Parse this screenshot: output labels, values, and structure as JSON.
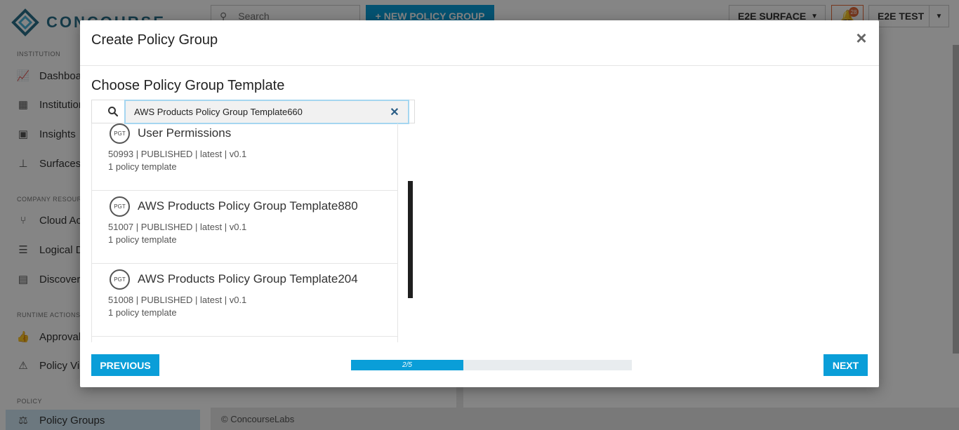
{
  "app": {
    "logo_text": "CONCOURSE",
    "search_placeholder": "Search",
    "new_policy_group_label": "NEW POLICY GROUP",
    "surface_selector": "E2E SURFACE",
    "notification_count": "28",
    "user_selector": "E2E TEST",
    "footer": "© ConcourseLabs"
  },
  "sidebar": {
    "sections": [
      {
        "label": "INSTITUTION",
        "items": [
          "Dashboard",
          "Institution",
          "Insights",
          "Surfaces"
        ]
      },
      {
        "label": "COMPANY RESOURCES",
        "items": [
          "Cloud Accounts",
          "Logical Deployables",
          "Discovery"
        ]
      },
      {
        "label": "RUNTIME ACTIONS",
        "items": [
          "Approvals",
          "Policy Violations"
        ]
      },
      {
        "label": "POLICY",
        "items": [
          "Policy Groups"
        ]
      }
    ]
  },
  "modal": {
    "title": "Create Policy Group",
    "section_title": "Choose Policy Group Template",
    "search_value": "AWS Products Policy Group Template660",
    "templates": [
      {
        "badge": "PGT",
        "name": "User Permissions",
        "meta": "50993 | PUBLISHED | latest | v0.1",
        "count": "1 policy template"
      },
      {
        "badge": "PGT",
        "name": "AWS Products Policy Group Template880",
        "meta": "51007 | PUBLISHED | latest | v0.1",
        "count": "1 policy template"
      },
      {
        "badge": "PGT",
        "name": "AWS Products Policy Group Template204",
        "meta": "51008 | PUBLISHED | latest | v0.1",
        "count": "1 policy template"
      }
    ],
    "previous_label": "PREVIOUS",
    "next_label": "NEXT",
    "progress": {
      "label": "2/5",
      "current": 2,
      "total": 5
    }
  },
  "colors": {
    "accent": "#0a9ed8",
    "notification": "#e36a3a"
  }
}
